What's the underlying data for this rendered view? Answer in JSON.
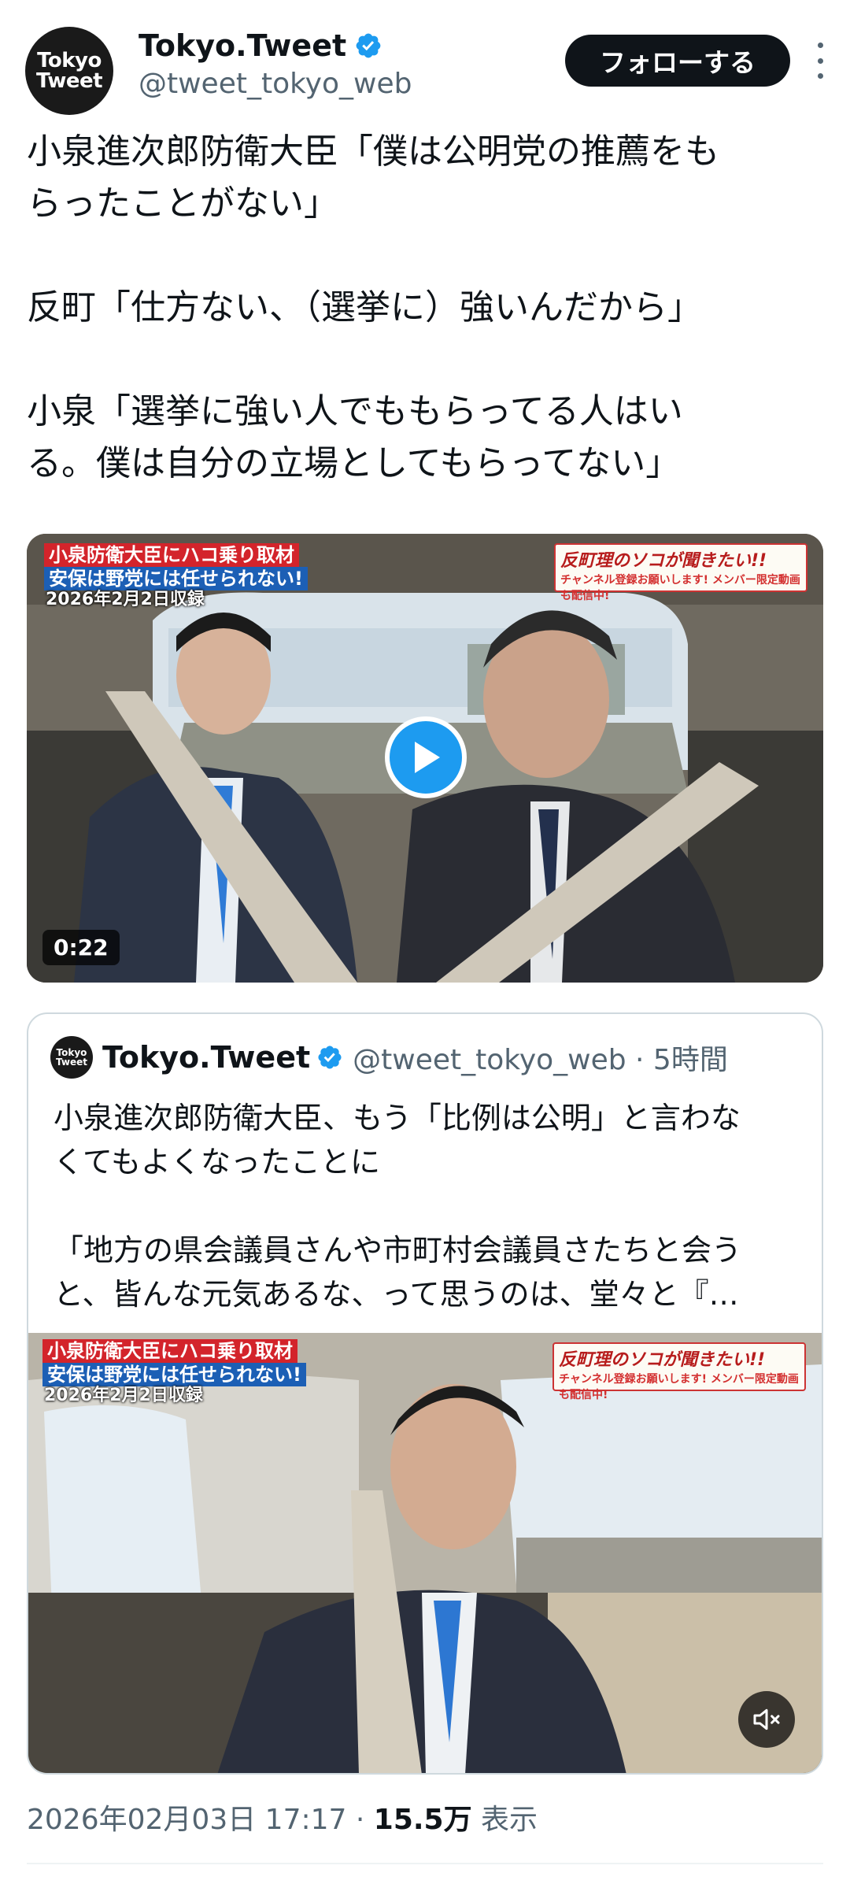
{
  "header": {
    "avatar_line1": "Tokyo",
    "avatar_line2": "Tweet",
    "name": "Tokyo.Tweet",
    "handle": "@tweet_tokyo_web",
    "follow_label": "フォローする"
  },
  "tweet": {
    "line1": "小泉進次郎防衛大臣「僕は公明党の推薦をも",
    "line2": "らったことがない」",
    "line3": "反町「仕方ない、（選挙に）強いんだから」",
    "line4": "小泉「選挙に強い人でももらってる人はい",
    "line5": "る。僕は自分の立場としてもらってない」"
  },
  "video": {
    "label_red": "小泉防衛大臣にハコ乗り取材",
    "label_blue": "安保は野党には任せられない!",
    "label_date": "2026年2月2日収録",
    "promo_title": "反町理のソコが聞きたい!!",
    "promo_sub": "チャンネル登録お願いします! メンバー限定動画も配信中!",
    "duration": "0:22"
  },
  "quote": {
    "avatar_line1": "Tokyo",
    "avatar_line2": "Tweet",
    "name": "Tokyo.Tweet",
    "meta": "@tweet_tokyo_web · 5時間",
    "line1": "小泉進次郎防衛大臣、もう「比例は公明」と言わな",
    "line2": "くてもよくなったことに",
    "line3": "「地方の県会議員さんや市町村会議員さたちと会う",
    "line4": "と、皆んな元気あるな、って思うのは、堂々と『…",
    "media": {
      "label_red": "小泉防衛大臣にハコ乗り取材",
      "label_blue": "安保は野党には任せられない!",
      "label_date": "2026年2月2日収録",
      "promo_title": "反町理のソコが聞きたい!!",
      "promo_sub": "チャンネル登録お願いします! メンバー限定動画も配信中!"
    }
  },
  "footer": {
    "timestamp": "2026年02月03日 17:17 · ",
    "views": "15.5万",
    "views_label": " 表示"
  },
  "colors": {
    "accent": "#1d9bf0",
    "text": "#0f1419",
    "secondary": "#536471",
    "border": "#cfd9de"
  },
  "icons": [
    "verified-badge-icon",
    "more-options-icon",
    "play-icon",
    "mute-icon"
  ]
}
